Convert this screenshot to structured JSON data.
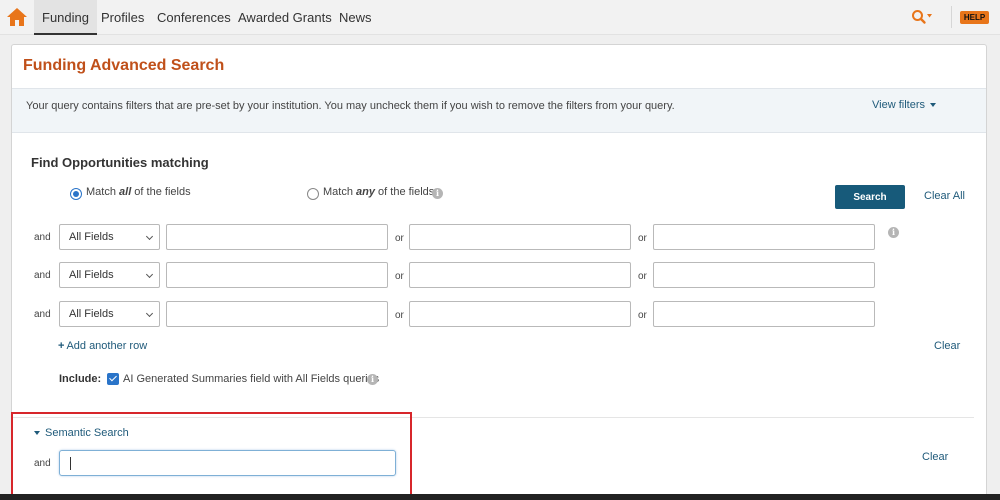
{
  "nav": {
    "items": [
      {
        "label": "Funding",
        "active": true
      },
      {
        "label": "Profiles",
        "active": false
      },
      {
        "label": "Conferences",
        "active": false
      },
      {
        "label": "Awarded Grants",
        "active": false
      },
      {
        "label": "News",
        "active": false
      }
    ],
    "help_label": "HELP",
    "icons": {
      "home": "home-icon",
      "search": "search-icon"
    },
    "accent_color": "#e8751a"
  },
  "page": {
    "title": "Funding Advanced Search",
    "title_color": "#c0501a",
    "info_text": "Your query contains filters that are pre-set by your institution. You may uncheck them if you wish to remove the filters from your query.",
    "view_filters_label": "View filters"
  },
  "find": {
    "title": "Find Opportunities matching",
    "match_all": {
      "prefix": "Match ",
      "emphasis": "all",
      "suffix": " of the fields",
      "checked": true
    },
    "match_any": {
      "prefix": "Match ",
      "emphasis": "any",
      "suffix": " of the fields",
      "checked": false
    },
    "search_label": "Search",
    "clear_all_label": "Clear All",
    "rows": [
      {
        "conjunction": "and",
        "field": "All Fields",
        "or1": "or",
        "or2": "or",
        "values": [
          "",
          "",
          ""
        ]
      },
      {
        "conjunction": "and",
        "field": "All Fields",
        "or1": "or",
        "or2": "or",
        "values": [
          "",
          "",
          ""
        ]
      },
      {
        "conjunction": "and",
        "field": "All Fields",
        "or1": "or",
        "or2": "or",
        "values": [
          "",
          "",
          ""
        ]
      }
    ],
    "add_row_label": "Add another row",
    "clear_label": "Clear",
    "include_label": "Include:",
    "include_option": "AI Generated Summaries field with All Fields queries",
    "include_checked": true,
    "button_color": "#175a7a"
  },
  "semantic": {
    "toggle_label": "Semantic Search",
    "conjunction": "and",
    "value": "",
    "clear_label": "Clear",
    "highlight_color": "#d7262b"
  }
}
